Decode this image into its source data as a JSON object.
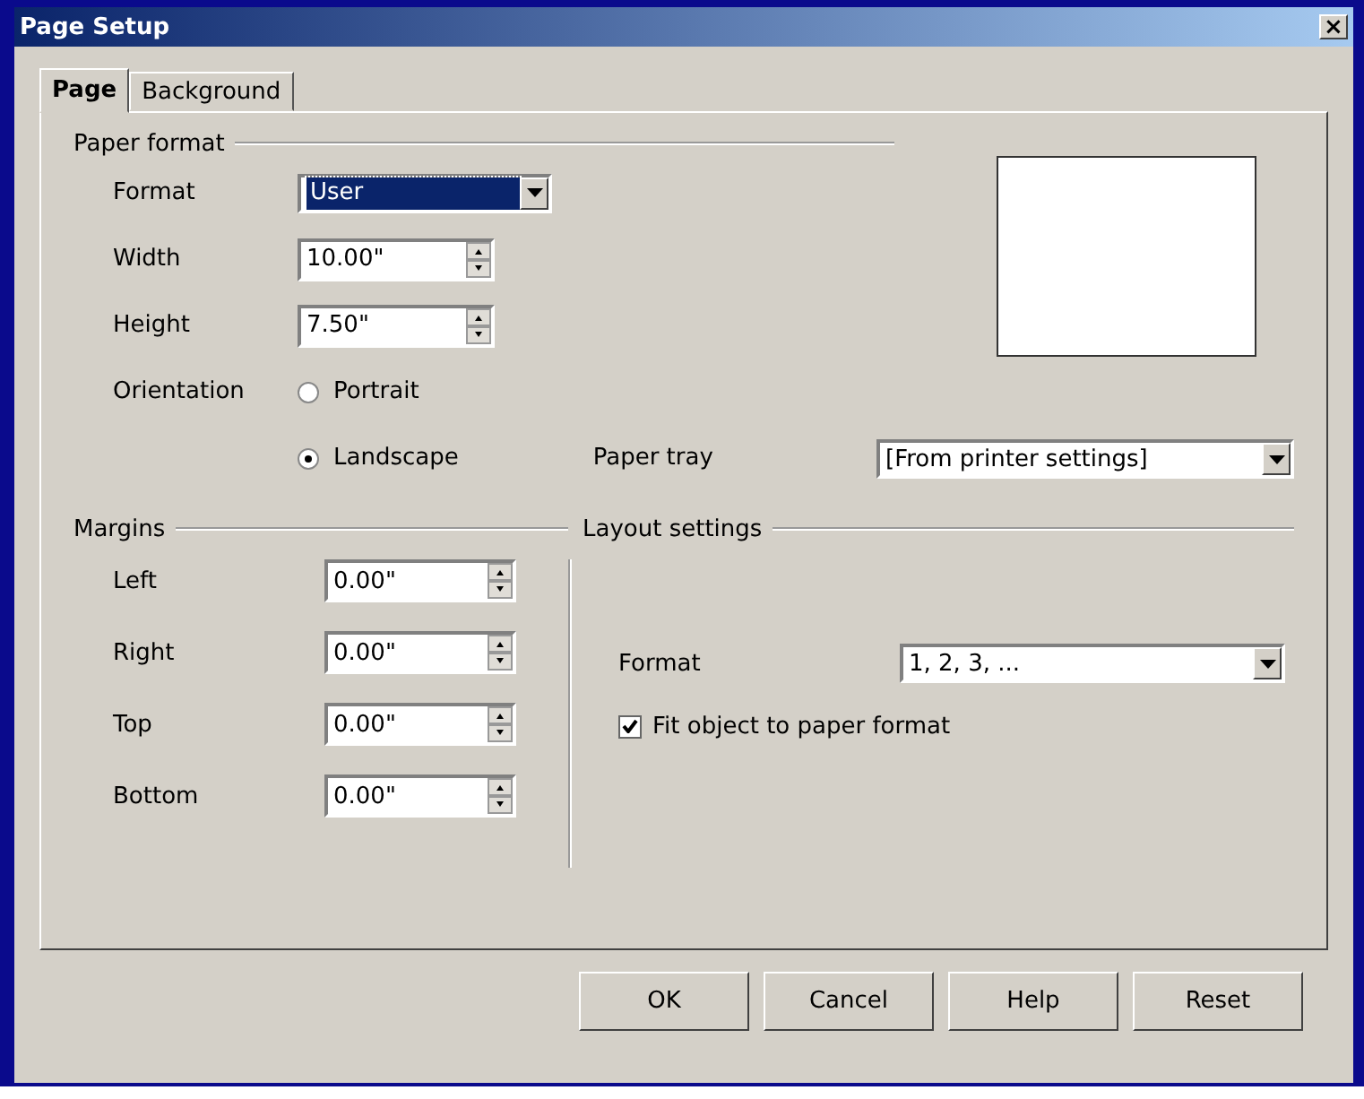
{
  "window": {
    "title": "Page Setup",
    "close": "×"
  },
  "tabs": [
    {
      "label": "Page",
      "selected": true
    },
    {
      "label": "Background",
      "selected": false
    }
  ],
  "paper_format": {
    "heading": "Paper format",
    "format": {
      "label": "Format",
      "value": "User",
      "focused": true
    },
    "width": {
      "label": "Width",
      "value": "10.00\""
    },
    "height": {
      "label": "Height",
      "value": "7.50\""
    },
    "orientation": {
      "label": "Orientation",
      "options": [
        {
          "label": "Portrait",
          "selected": false
        },
        {
          "label": "Landscape",
          "selected": true
        }
      ]
    },
    "paper_tray": {
      "label": "Paper tray",
      "value": "[From printer settings]"
    }
  },
  "margins": {
    "heading": "Margins",
    "fields": [
      {
        "label": "Left",
        "value": "0.00\""
      },
      {
        "label": "Right",
        "value": "0.00\""
      },
      {
        "label": "Top",
        "value": "0.00\""
      },
      {
        "label": "Bottom",
        "value": "0.00\""
      }
    ]
  },
  "layout_settings": {
    "heading": "Layout settings",
    "format": {
      "label": "Format",
      "value": "1, 2, 3, ..."
    },
    "fit_object": {
      "label": "Fit object to paper format",
      "checked": true
    }
  },
  "buttons": [
    {
      "label": "OK"
    },
    {
      "label": "Cancel"
    },
    {
      "label": "Help"
    },
    {
      "label": "Reset"
    }
  ]
}
